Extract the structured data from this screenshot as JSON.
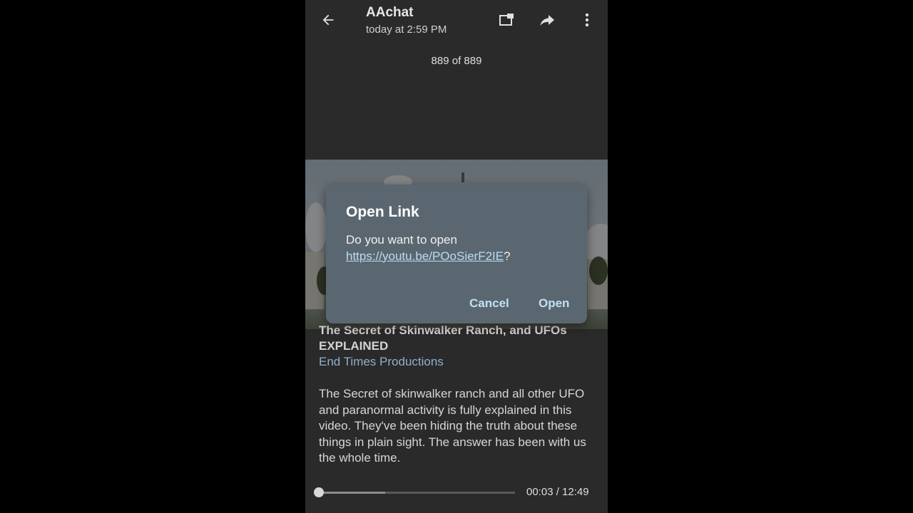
{
  "header": {
    "title": "AAchat",
    "subtitle": "today at 2:59 PM",
    "back_icon": "arrow-left-icon",
    "actions": [
      "picture-in-picture-icon",
      "share-icon",
      "more-vert-icon"
    ]
  },
  "counter": "889 of 889",
  "video": {
    "title": "The Secret of Skinwalker Ranch, and UFOs EXPLAINED",
    "channel": "End Times Productions",
    "description": "The Secret of skinwalker ranch and all other UFO and paranormal activity is fully explained in this video. They've been hiding the truth about these things in plain sight. The answer has been with us the whole time.",
    "time": "00:03 / 12:49",
    "buffered_fraction": 0.34,
    "played_fraction": 0.004
  },
  "dialog": {
    "title": "Open Link",
    "message_prefix": "Do you want to open ",
    "link": "https://youtu.be/POoSierF2IE",
    "message_suffix": "?",
    "cancel_label": "Cancel",
    "open_label": "Open"
  },
  "colors": {
    "background": "#2a2a2a",
    "dialog": "#5b6770",
    "accent": "#bfe1f5",
    "channel_link": "#8fb0cc"
  }
}
